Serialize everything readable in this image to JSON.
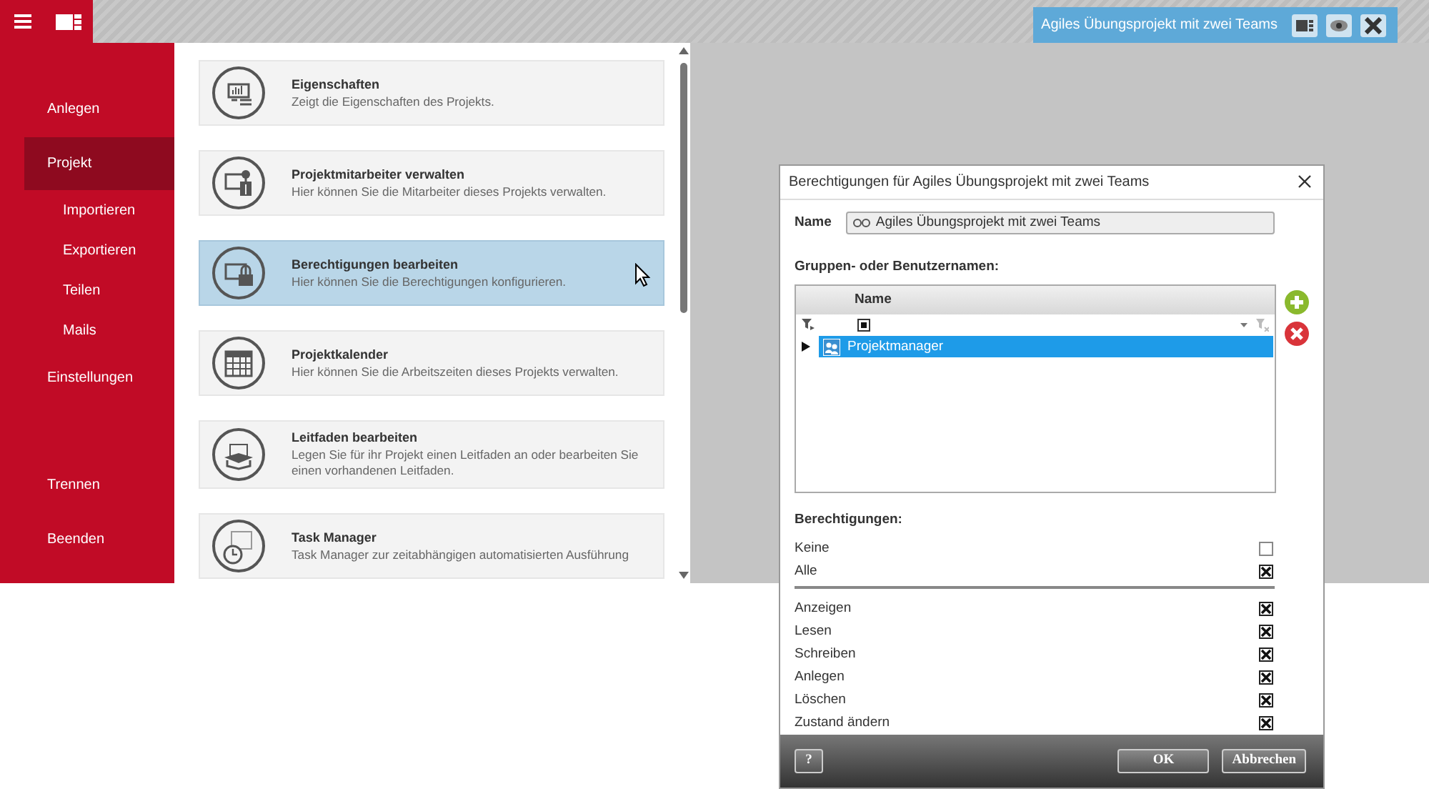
{
  "topbar": {
    "project_tag": "Agiles Übungsprojekt mit zwei Teams"
  },
  "sidebar": {
    "items": [
      {
        "label": "Anlegen",
        "kind": "main",
        "selected": false
      },
      {
        "label": "Projekt",
        "kind": "main",
        "selected": true
      },
      {
        "label": "Importieren",
        "kind": "sub",
        "selected": false
      },
      {
        "label": "Exportieren",
        "kind": "sub",
        "selected": false
      },
      {
        "label": "Teilen",
        "kind": "sub",
        "selected": false
      },
      {
        "label": "Mails",
        "kind": "sub",
        "selected": false
      },
      {
        "label": "Einstellungen",
        "kind": "main",
        "selected": false
      }
    ],
    "bottom_items": [
      {
        "label": "Trennen"
      },
      {
        "label": "Beenden"
      }
    ]
  },
  "cards": [
    {
      "title": "Eigenschaften",
      "description": "Zeigt die Eigenschaften des Projekts.",
      "selected": false
    },
    {
      "title": "Projektmitarbeiter verwalten",
      "description": "Hier können Sie die Mitarbeiter dieses Projekts verwalten.",
      "selected": false
    },
    {
      "title": "Berechtigungen bearbeiten",
      "description": "Hier können Sie die Berechtigungen konfigurieren.",
      "selected": true
    },
    {
      "title": "Projektkalender",
      "description": "Hier können Sie die Arbeitszeiten dieses Projekts verwalten.",
      "selected": false
    },
    {
      "title": "Leitfaden bearbeiten",
      "description": "Legen Sie für ihr Projekt einen Leitfaden an oder bearbeiten Sie einen vorhandenen Leitfaden.",
      "selected": false
    },
    {
      "title": "Task Manager",
      "description": "Task Manager zur zeitabhängigen automatisierten Ausführung",
      "selected": false
    }
  ],
  "dialog": {
    "title": "Berechtigungen für Agiles Übungsprojekt mit zwei Teams",
    "name_label": "Name",
    "name_value": "Agiles Übungsprojekt mit zwei Teams",
    "groups_label": "Gruppen- oder Benutzernamen:",
    "table": {
      "columns": [
        "Name"
      ],
      "rows": [
        {
          "name": "Projektmanager",
          "selected": true
        }
      ]
    },
    "permissions_label": "Berechtigungen:",
    "presets": [
      {
        "label": "Keine",
        "checked": false
      },
      {
        "label": "Alle",
        "checked": true
      }
    ],
    "permissions": [
      {
        "label": "Anzeigen",
        "checked": true
      },
      {
        "label": "Lesen",
        "checked": true
      },
      {
        "label": "Schreiben",
        "checked": true
      },
      {
        "label": "Anlegen",
        "checked": true
      },
      {
        "label": "Löschen",
        "checked": true
      },
      {
        "label": "Zustand ändern",
        "checked": true
      }
    ],
    "help_button": "?",
    "buttons": [
      "OK",
      "Abbrechen"
    ]
  }
}
